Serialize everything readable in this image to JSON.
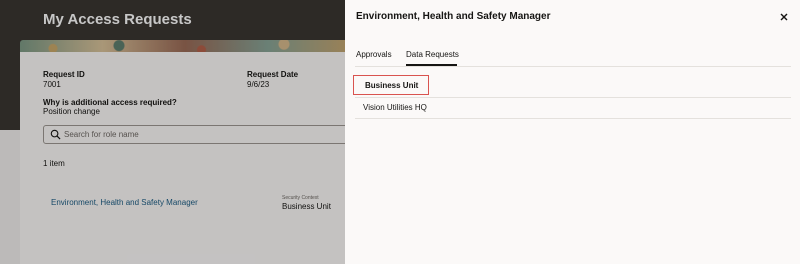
{
  "page": {
    "title": "My Access Requests"
  },
  "request": {
    "id_label": "Request ID",
    "id_value": "7001",
    "date_label": "Request Date",
    "date_value": "9/6/23",
    "reason_label": "Why is additional access required?",
    "reason_value": "Position change"
  },
  "search": {
    "placeholder": "Search for role name",
    "icon": "search-icon"
  },
  "results": {
    "count_text": "1 item",
    "rows": [
      {
        "role": "Environment, Health and Safety Manager",
        "context_label": "Security Context",
        "context_value": "Business Unit"
      }
    ]
  },
  "drawer": {
    "title": "Environment, Health and Safety Manager",
    "close_icon": "close-icon",
    "tabs": [
      {
        "label": "Approvals",
        "active": false
      },
      {
        "label": "Data Requests",
        "active": true
      }
    ],
    "table": {
      "header": "Business Unit",
      "rows": [
        "Vision Utilities HQ"
      ]
    }
  },
  "colors": {
    "header_bg": "#3a3631",
    "link": "#1d5d84",
    "highlight_border": "#d9534f"
  }
}
